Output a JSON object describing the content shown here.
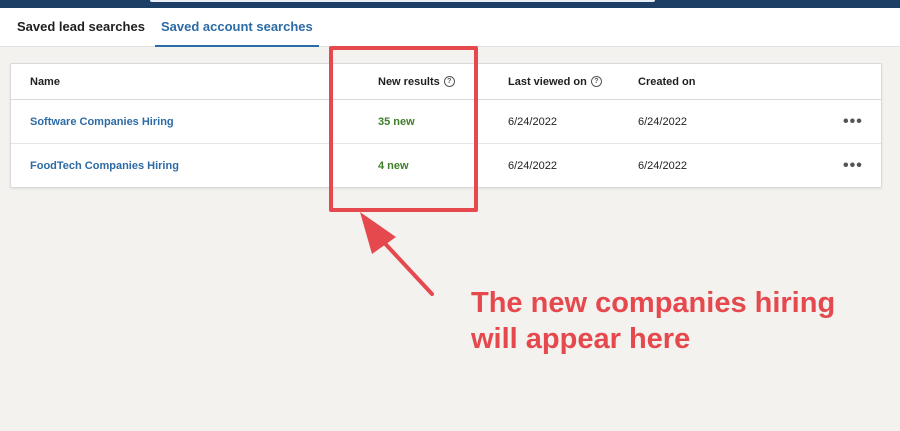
{
  "tabs": [
    {
      "label": "Saved lead searches"
    },
    {
      "label": "Saved account searches"
    }
  ],
  "table": {
    "columns": [
      "Name",
      "New results",
      "Last viewed on",
      "Created on"
    ],
    "help_glyph": "?",
    "rows": [
      {
        "name": "Software Companies Hiring",
        "new_results": "35 new",
        "last_viewed": "6/24/2022",
        "created": "6/24/2022",
        "more": "•••"
      },
      {
        "name": "FoodTech Companies Hiring",
        "new_results": "4 new",
        "last_viewed": "6/24/2022",
        "created": "6/24/2022",
        "more": "•••"
      }
    ]
  },
  "annotation": {
    "line1": "The new companies hiring",
    "line2": "will appear here",
    "color": "#e5484d"
  },
  "colors": {
    "link": "#2c6ba5",
    "new_results": "#3f7d2a",
    "topbar": "#1d3f66"
  }
}
